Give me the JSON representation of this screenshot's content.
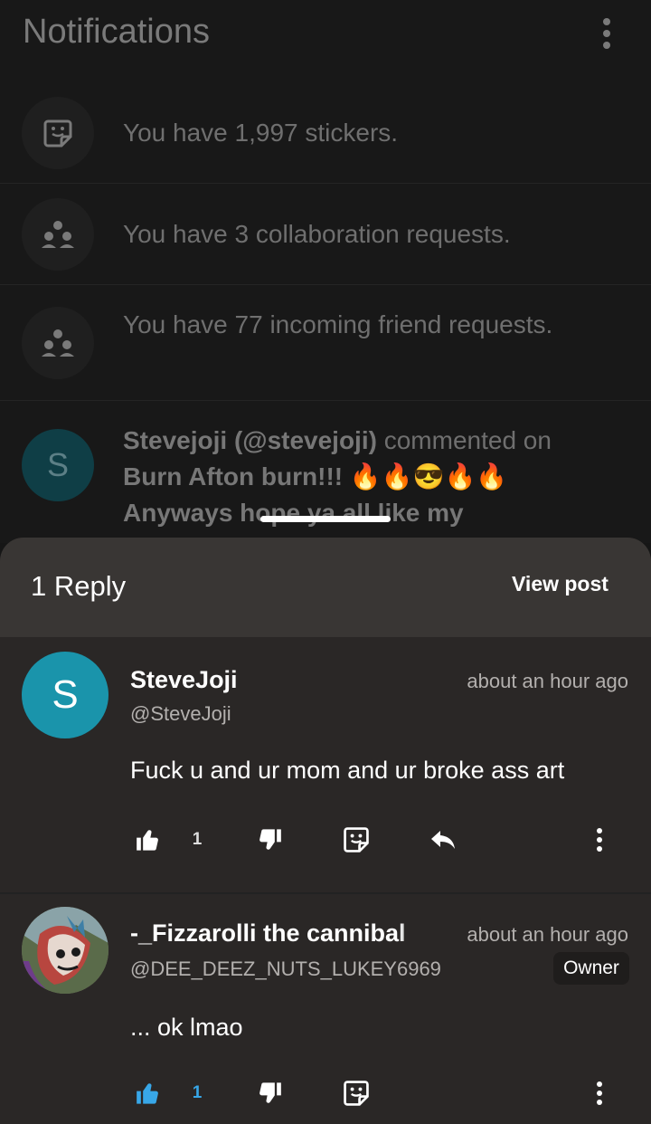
{
  "header": {
    "title": "Notifications"
  },
  "notifications": [
    {
      "icon": "sticker-icon",
      "text": "You have 1,997 stickers."
    },
    {
      "icon": "collab-icon",
      "text": "You have 3 collaboration requests."
    },
    {
      "icon": "friends-icon",
      "text": "You have 77 incoming friend requests."
    },
    {
      "avatar_letter": "S",
      "user": "Stevejoji (@stevejoji)",
      "action": " commented on ",
      "post": "Burn Afton burn!!! 🔥🔥😎🔥🔥",
      "preview": "Anyways hope ya all like my"
    }
  ],
  "sheet": {
    "reply_count": "1 Reply",
    "view_post": "View post"
  },
  "comments": [
    {
      "avatar_letter": "S",
      "name": "SteveJoji",
      "handle": "@SteveJoji",
      "time": "about an hour ago",
      "text": "Fuck u and ur mom and ur broke ass art",
      "likes": "1",
      "liked": false
    },
    {
      "name": "-_Fizzarolli the cannibal",
      "handle": "@DEE_DEEZ_NUTS_LUKEY6969",
      "time": "about an hour ago",
      "badge": "Owner",
      "text": "... ok lmao",
      "likes": "1",
      "liked": true
    }
  ],
  "colors": {
    "accent_blue": "#38a7e8",
    "avatar_teal": "#1a94ab"
  }
}
